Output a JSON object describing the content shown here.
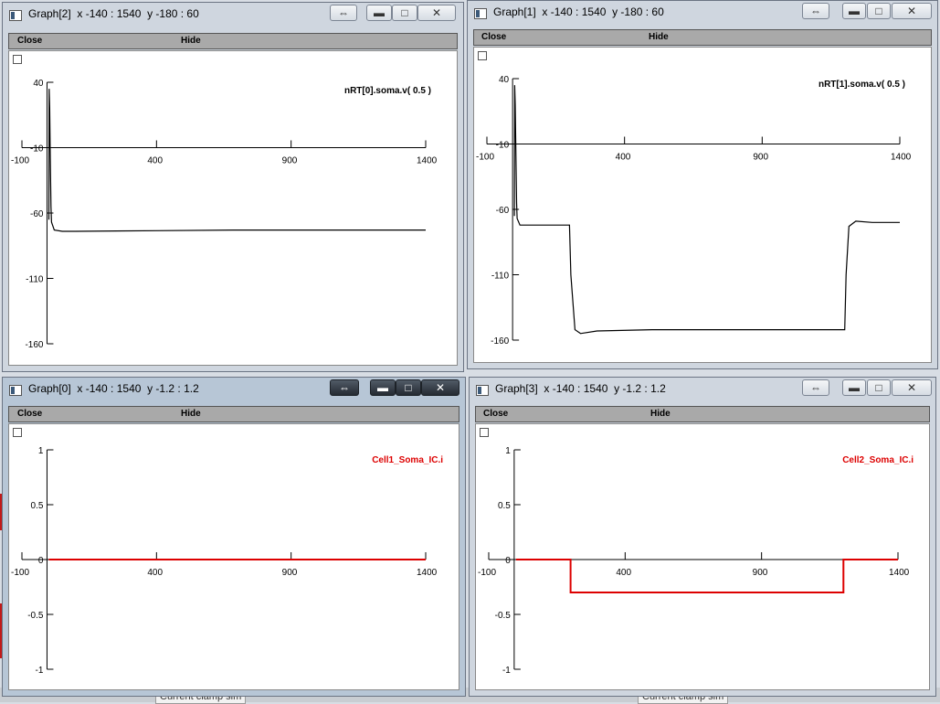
{
  "windows": [
    {
      "id": "graph2",
      "title": "Graph[2]  x -140 : 1540  y -180 : 60",
      "close_label": "Close",
      "hide_label": "Hide",
      "active": false,
      "controls": {
        "restore_icon": "double-arrow-icon",
        "minimize_icon": "minimize-icon",
        "maximize_icon": "maximize-icon",
        "close_icon": "close-icon"
      },
      "xticks": [
        "-100",
        "400",
        "900",
        "1400"
      ],
      "yticks": [
        "40",
        "-10",
        "-60",
        "-110",
        "-160"
      ]
    },
    {
      "id": "graph1",
      "title": "Graph[1]  x -140 : 1540  y -180 : 60",
      "close_label": "Close",
      "hide_label": "Hide",
      "active": false,
      "controls": {
        "restore_icon": "double-arrow-icon",
        "minimize_icon": "minimize-icon",
        "maximize_icon": "maximize-icon",
        "close_icon": "close-icon"
      },
      "xticks": [
        "-100",
        "400",
        "900",
        "1400"
      ],
      "yticks": [
        "40",
        "-10",
        "-60",
        "-110",
        "-160"
      ]
    },
    {
      "id": "graph0",
      "title": "Graph[0]  x -140 : 1540  y -1.2 : 1.2",
      "close_label": "Close",
      "hide_label": "Hide",
      "active": true,
      "controls": {
        "restore_icon": "double-arrow-icon",
        "minimize_icon": "minimize-icon",
        "maximize_icon": "maximize-icon",
        "close_icon": "close-icon"
      },
      "xticks": [
        "-100",
        "400",
        "900",
        "1400"
      ],
      "yticks": [
        "1",
        "0.5",
        "0",
        "-0.5",
        "-1"
      ]
    },
    {
      "id": "graph3",
      "title": "Graph[3]  x -140 : 1540  y -1.2 : 1.2",
      "close_label": "Close",
      "hide_label": "Hide",
      "active": false,
      "controls": {
        "restore_icon": "double-arrow-icon",
        "minimize_icon": "minimize-icon",
        "maximize_icon": "maximize-icon",
        "close_icon": "close-icon"
      },
      "xticks": [
        "-100",
        "400",
        "900",
        "1400"
      ],
      "yticks": [
        "1",
        "0.5",
        "0",
        "-0.5",
        "-1"
      ]
    }
  ],
  "taskbar_fragments": [
    "Current clamp sim",
    "Current clamp sim"
  ],
  "chart_data": [
    {
      "window": "Graph[2]",
      "type": "line",
      "xlim": [
        -140,
        1540
      ],
      "ylim": [
        -180,
        60
      ],
      "xticks": [
        -100,
        400,
        900,
        1400
      ],
      "yticks": [
        40,
        -10,
        -60,
        -110,
        -160
      ],
      "color": "#000000",
      "series": [
        {
          "name": "nRT[0].soma.v( 0.5 )",
          "x": [
            0,
            1,
            3,
            5,
            8,
            10,
            20,
            50,
            100,
            400,
            700,
            1000,
            1400
          ],
          "y": [
            -65,
            35,
            20,
            -10,
            -55,
            -67,
            -73,
            -74,
            -74,
            -73.5,
            -73,
            -73,
            -73
          ]
        }
      ]
    },
    {
      "window": "Graph[1]",
      "type": "line",
      "xlim": [
        -140,
        1540
      ],
      "ylim": [
        -180,
        60
      ],
      "xticks": [
        -100,
        400,
        900,
        1400
      ],
      "yticks": [
        40,
        -10,
        -60,
        -110,
        -160
      ],
      "color": "#000000",
      "series": [
        {
          "name": "nRT[1].soma.v( 0.5 )",
          "x": [
            0,
            1,
            3,
            5,
            8,
            10,
            20,
            100,
            200,
            205,
            220,
            240,
            300,
            500,
            800,
            1100,
            1200,
            1205,
            1215,
            1240,
            1300,
            1400
          ],
          "y": [
            -65,
            35,
            20,
            -10,
            -55,
            -67,
            -72,
            -72,
            -72,
            -110,
            -152,
            -155,
            -153,
            -152,
            -152,
            -152,
            -152,
            -110,
            -73,
            -69,
            -70,
            -70
          ]
        }
      ]
    },
    {
      "window": "Graph[0]",
      "type": "line",
      "xlim": [
        -140,
        1540
      ],
      "ylim": [
        -1.2,
        1.2
      ],
      "xticks": [
        -100,
        400,
        900,
        1400
      ],
      "yticks": [
        1,
        0.5,
        0,
        -0.5,
        -1
      ],
      "color": "#dd0000",
      "series": [
        {
          "name": "Cell1_Soma_IC.i",
          "x": [
            0,
            1400
          ],
          "y": [
            0,
            0
          ]
        }
      ]
    },
    {
      "window": "Graph[3]",
      "type": "line",
      "xlim": [
        -140,
        1540
      ],
      "ylim": [
        -1.2,
        1.2
      ],
      "xticks": [
        -100,
        400,
        900,
        1400
      ],
      "yticks": [
        1,
        0.5,
        0,
        -0.5,
        -1
      ],
      "color": "#dd0000",
      "series": [
        {
          "name": "Cell2_Soma_IC.i",
          "x": [
            0,
            200,
            200,
            1200,
            1200,
            1400
          ],
          "y": [
            0,
            0,
            -0.3,
            -0.3,
            0,
            0
          ]
        }
      ]
    }
  ]
}
